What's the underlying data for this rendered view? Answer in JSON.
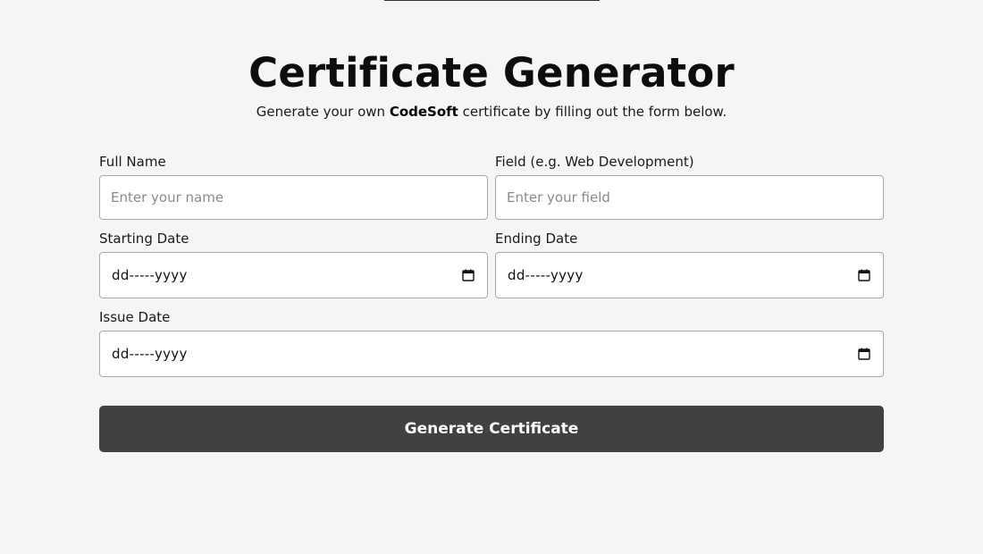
{
  "header": {
    "title": "Certificate Generator",
    "subtitle_before": "Generate your own ",
    "subtitle_brand": "CodeSoft",
    "subtitle_after": " certificate by filling out the form below."
  },
  "form": {
    "full_name": {
      "label": "Full Name",
      "placeholder": "Enter your name",
      "value": ""
    },
    "field": {
      "label": "Field (e.g. Web Development)",
      "placeholder": "Enter your field",
      "value": ""
    },
    "starting_date": {
      "label": "Starting Date",
      "display": "dd-----yyyy",
      "icon": "calendar-icon"
    },
    "ending_date": {
      "label": "Ending Date",
      "display": "dd-----yyyy",
      "icon": "calendar-icon"
    },
    "issue_date": {
      "label": "Issue Date",
      "display": "dd-----yyyy",
      "icon": "calendar-icon"
    },
    "submit_label": "Generate Certificate"
  },
  "colors": {
    "background": "#f5f5f5",
    "button": "#434140",
    "button_text": "#ffffff",
    "input_border": "#a9a9a9"
  }
}
